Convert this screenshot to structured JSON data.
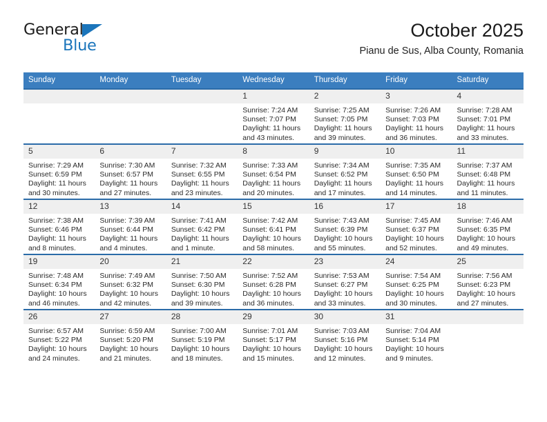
{
  "brand": {
    "name_part1": "General",
    "name_part2": "Blue",
    "triangle_color": "#1b75bb"
  },
  "header": {
    "title": "October 2025",
    "subtitle": "Pianu de Sus, Alba County, Romania"
  },
  "theme": {
    "header_row_bg": "#3b7ebf",
    "week_divider": "#2a6ba8",
    "daynum_bg": "#efefef",
    "text": "#2a2a2a"
  },
  "weekdays": [
    "Sunday",
    "Monday",
    "Tuesday",
    "Wednesday",
    "Thursday",
    "Friday",
    "Saturday"
  ],
  "labels": {
    "sunrise": "Sunrise:",
    "sunset": "Sunset:",
    "daylight": "Daylight:"
  },
  "weeks": [
    [
      {
        "day": "",
        "empty": true
      },
      {
        "day": "",
        "empty": true
      },
      {
        "day": "",
        "empty": true
      },
      {
        "day": "1",
        "sunrise": "Sunrise: 7:24 AM",
        "sunset": "Sunset: 7:07 PM",
        "daylight_line1": "Daylight: 11 hours",
        "daylight_line2": "and 43 minutes."
      },
      {
        "day": "2",
        "sunrise": "Sunrise: 7:25 AM",
        "sunset": "Sunset: 7:05 PM",
        "daylight_line1": "Daylight: 11 hours",
        "daylight_line2": "and 39 minutes."
      },
      {
        "day": "3",
        "sunrise": "Sunrise: 7:26 AM",
        "sunset": "Sunset: 7:03 PM",
        "daylight_line1": "Daylight: 11 hours",
        "daylight_line2": "and 36 minutes."
      },
      {
        "day": "4",
        "sunrise": "Sunrise: 7:28 AM",
        "sunset": "Sunset: 7:01 PM",
        "daylight_line1": "Daylight: 11 hours",
        "daylight_line2": "and 33 minutes."
      }
    ],
    [
      {
        "day": "5",
        "sunrise": "Sunrise: 7:29 AM",
        "sunset": "Sunset: 6:59 PM",
        "daylight_line1": "Daylight: 11 hours",
        "daylight_line2": "and 30 minutes."
      },
      {
        "day": "6",
        "sunrise": "Sunrise: 7:30 AM",
        "sunset": "Sunset: 6:57 PM",
        "daylight_line1": "Daylight: 11 hours",
        "daylight_line2": "and 27 minutes."
      },
      {
        "day": "7",
        "sunrise": "Sunrise: 7:32 AM",
        "sunset": "Sunset: 6:55 PM",
        "daylight_line1": "Daylight: 11 hours",
        "daylight_line2": "and 23 minutes."
      },
      {
        "day": "8",
        "sunrise": "Sunrise: 7:33 AM",
        "sunset": "Sunset: 6:54 PM",
        "daylight_line1": "Daylight: 11 hours",
        "daylight_line2": "and 20 minutes."
      },
      {
        "day": "9",
        "sunrise": "Sunrise: 7:34 AM",
        "sunset": "Sunset: 6:52 PM",
        "daylight_line1": "Daylight: 11 hours",
        "daylight_line2": "and 17 minutes."
      },
      {
        "day": "10",
        "sunrise": "Sunrise: 7:35 AM",
        "sunset": "Sunset: 6:50 PM",
        "daylight_line1": "Daylight: 11 hours",
        "daylight_line2": "and 14 minutes."
      },
      {
        "day": "11",
        "sunrise": "Sunrise: 7:37 AM",
        "sunset": "Sunset: 6:48 PM",
        "daylight_line1": "Daylight: 11 hours",
        "daylight_line2": "and 11 minutes."
      }
    ],
    [
      {
        "day": "12",
        "sunrise": "Sunrise: 7:38 AM",
        "sunset": "Sunset: 6:46 PM",
        "daylight_line1": "Daylight: 11 hours",
        "daylight_line2": "and 8 minutes."
      },
      {
        "day": "13",
        "sunrise": "Sunrise: 7:39 AM",
        "sunset": "Sunset: 6:44 PM",
        "daylight_line1": "Daylight: 11 hours",
        "daylight_line2": "and 4 minutes."
      },
      {
        "day": "14",
        "sunrise": "Sunrise: 7:41 AM",
        "sunset": "Sunset: 6:42 PM",
        "daylight_line1": "Daylight: 11 hours",
        "daylight_line2": "and 1 minute."
      },
      {
        "day": "15",
        "sunrise": "Sunrise: 7:42 AM",
        "sunset": "Sunset: 6:41 PM",
        "daylight_line1": "Daylight: 10 hours",
        "daylight_line2": "and 58 minutes."
      },
      {
        "day": "16",
        "sunrise": "Sunrise: 7:43 AM",
        "sunset": "Sunset: 6:39 PM",
        "daylight_line1": "Daylight: 10 hours",
        "daylight_line2": "and 55 minutes."
      },
      {
        "day": "17",
        "sunrise": "Sunrise: 7:45 AM",
        "sunset": "Sunset: 6:37 PM",
        "daylight_line1": "Daylight: 10 hours",
        "daylight_line2": "and 52 minutes."
      },
      {
        "day": "18",
        "sunrise": "Sunrise: 7:46 AM",
        "sunset": "Sunset: 6:35 PM",
        "daylight_line1": "Daylight: 10 hours",
        "daylight_line2": "and 49 minutes."
      }
    ],
    [
      {
        "day": "19",
        "sunrise": "Sunrise: 7:48 AM",
        "sunset": "Sunset: 6:34 PM",
        "daylight_line1": "Daylight: 10 hours",
        "daylight_line2": "and 46 minutes."
      },
      {
        "day": "20",
        "sunrise": "Sunrise: 7:49 AM",
        "sunset": "Sunset: 6:32 PM",
        "daylight_line1": "Daylight: 10 hours",
        "daylight_line2": "and 42 minutes."
      },
      {
        "day": "21",
        "sunrise": "Sunrise: 7:50 AM",
        "sunset": "Sunset: 6:30 PM",
        "daylight_line1": "Daylight: 10 hours",
        "daylight_line2": "and 39 minutes."
      },
      {
        "day": "22",
        "sunrise": "Sunrise: 7:52 AM",
        "sunset": "Sunset: 6:28 PM",
        "daylight_line1": "Daylight: 10 hours",
        "daylight_line2": "and 36 minutes."
      },
      {
        "day": "23",
        "sunrise": "Sunrise: 7:53 AM",
        "sunset": "Sunset: 6:27 PM",
        "daylight_line1": "Daylight: 10 hours",
        "daylight_line2": "and 33 minutes."
      },
      {
        "day": "24",
        "sunrise": "Sunrise: 7:54 AM",
        "sunset": "Sunset: 6:25 PM",
        "daylight_line1": "Daylight: 10 hours",
        "daylight_line2": "and 30 minutes."
      },
      {
        "day": "25",
        "sunrise": "Sunrise: 7:56 AM",
        "sunset": "Sunset: 6:23 PM",
        "daylight_line1": "Daylight: 10 hours",
        "daylight_line2": "and 27 minutes."
      }
    ],
    [
      {
        "day": "26",
        "sunrise": "Sunrise: 6:57 AM",
        "sunset": "Sunset: 5:22 PM",
        "daylight_line1": "Daylight: 10 hours",
        "daylight_line2": "and 24 minutes."
      },
      {
        "day": "27",
        "sunrise": "Sunrise: 6:59 AM",
        "sunset": "Sunset: 5:20 PM",
        "daylight_line1": "Daylight: 10 hours",
        "daylight_line2": "and 21 minutes."
      },
      {
        "day": "28",
        "sunrise": "Sunrise: 7:00 AM",
        "sunset": "Sunset: 5:19 PM",
        "daylight_line1": "Daylight: 10 hours",
        "daylight_line2": "and 18 minutes."
      },
      {
        "day": "29",
        "sunrise": "Sunrise: 7:01 AM",
        "sunset": "Sunset: 5:17 PM",
        "daylight_line1": "Daylight: 10 hours",
        "daylight_line2": "and 15 minutes."
      },
      {
        "day": "30",
        "sunrise": "Sunrise: 7:03 AM",
        "sunset": "Sunset: 5:16 PM",
        "daylight_line1": "Daylight: 10 hours",
        "daylight_line2": "and 12 minutes."
      },
      {
        "day": "31",
        "sunrise": "Sunrise: 7:04 AM",
        "sunset": "Sunset: 5:14 PM",
        "daylight_line1": "Daylight: 10 hours",
        "daylight_line2": "and 9 minutes."
      },
      {
        "day": "",
        "empty": true
      }
    ]
  ]
}
